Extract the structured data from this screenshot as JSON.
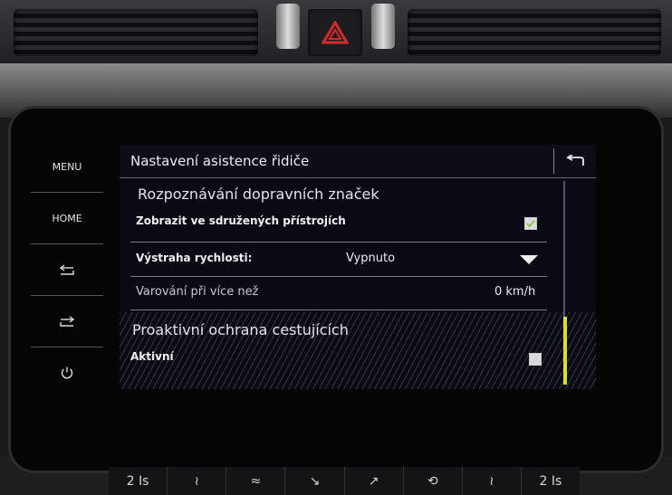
{
  "side_keys": {
    "menu": "MENU",
    "home": "HOME"
  },
  "header": {
    "title": "Nastavení asistence řidiče"
  },
  "traffic_sign_recognition": {
    "title": "Rozpoznávání dopravních značek",
    "show_in_cluster_label": "Zobrazit ve sdružených přístrojích",
    "show_in_cluster_checked": true,
    "speed_warning_label": "Výstraha rychlosti:",
    "speed_warning_value": "Vypnuto",
    "warn_over_label": "Varování při více než",
    "warn_over_value": "0 km/h"
  },
  "proactive_protection": {
    "title": "Proaktivní ochrana cestujících",
    "active_label": "Aktivní",
    "active_checked": false
  },
  "bottom_strip": {
    "left_temp": "2 Is",
    "right_temp": "2 Is"
  },
  "colors": {
    "check_green": "#8bc34a",
    "scroll_thumb": "#d5e21a",
    "hazard_red": "#d42a2a"
  }
}
